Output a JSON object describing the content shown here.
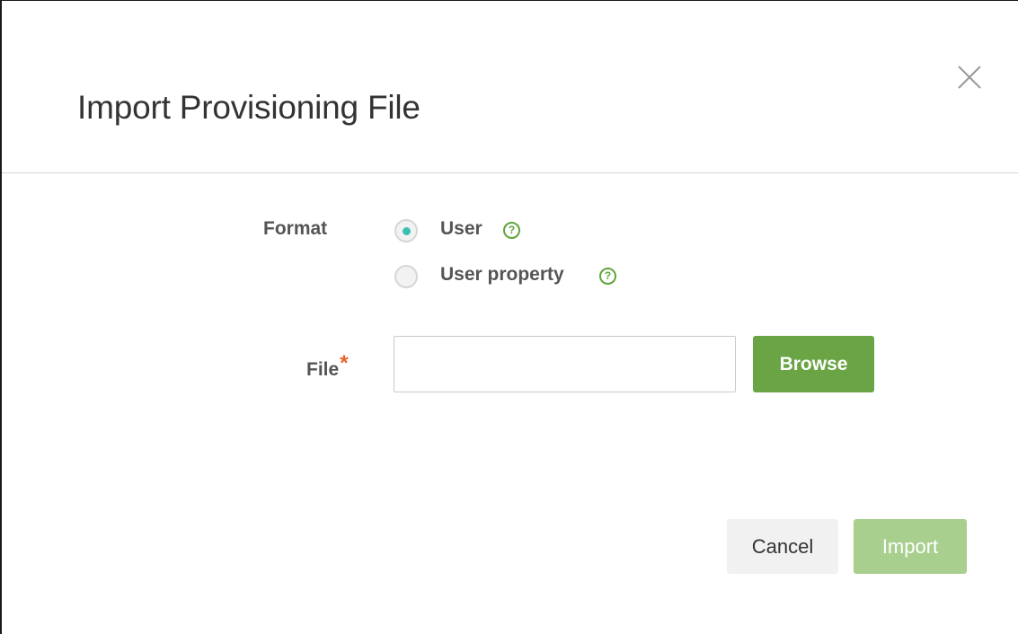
{
  "dialog": {
    "title": "Import Provisioning File",
    "close_icon": "close-icon"
  },
  "form": {
    "format": {
      "label": "Format",
      "options": [
        {
          "label": "User",
          "checked": true,
          "help_icon": "help-icon",
          "help_glyph": "?"
        },
        {
          "label": "User property",
          "checked": false,
          "help_icon": "help-icon",
          "help_glyph": "?"
        }
      ]
    },
    "file": {
      "label": "File",
      "required_mark": "*",
      "value": "",
      "placeholder": "",
      "browse_label": "Browse"
    }
  },
  "footer": {
    "cancel_label": "Cancel",
    "import_label": "Import"
  },
  "colors": {
    "accent_green": "#6aa444",
    "disabled_green": "#a8cf8e",
    "radio_teal": "#3dbfb0",
    "required_orange": "#e8632b",
    "help_green": "#5fa43a"
  }
}
